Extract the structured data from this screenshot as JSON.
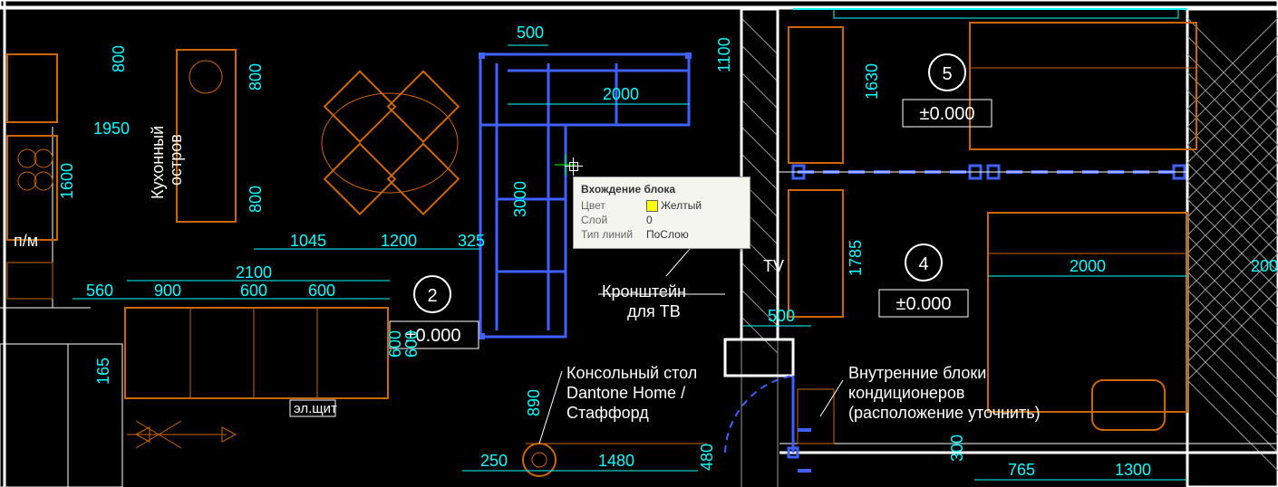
{
  "tooltip": {
    "title": "Вхождение блока",
    "color_label": "Цвет",
    "color_value": "Желтый",
    "layer_label": "Слой",
    "layer_value": "0",
    "linetype_label": "Тип линий",
    "linetype_value": "ПоСлою"
  },
  "labels": {
    "kitchen_island_1": "Кухонный",
    "kitchen_island_2": "остров",
    "pm": "п/м",
    "tv_bracket_1": "Кронштейн",
    "tv_bracket_2": "для ТВ",
    "console_1": "Консольный стол",
    "console_2": "Dantone Home /",
    "console_3": "Стаффорд",
    "tv": "TV",
    "ac_1": "Внутренние блоки",
    "ac_2": "кондиционеров",
    "ac_3": "(расположение уточнить)",
    "panel": "эл.щит"
  },
  "rooms": {
    "r2": {
      "num": "2",
      "elev": "±0.000"
    },
    "r4": {
      "num": "4",
      "elev": "±0.000"
    },
    "r5": {
      "num": "5",
      "elev": "±0.000"
    }
  },
  "dims": {
    "d500": "500",
    "d800a": "800",
    "d800b": "800",
    "d800c": "800",
    "d1950": "1950",
    "d1600": "1600",
    "d2000": "2000",
    "d1100": "1100",
    "d1630": "1630",
    "d3000": "3000",
    "d1785": "1785",
    "d1045": "1045",
    "d1200": "1200",
    "d325": "325",
    "d2100": "2100",
    "d560": "560",
    "d900": "900",
    "d600a": "600",
    "d600b": "600",
    "d600c": "600",
    "d600d": "600",
    "d165": "165",
    "d890": "890",
    "d250": "250",
    "d1480": "1480",
    "d500b": "500",
    "d480": "480",
    "d2000b": "2000",
    "d200": "200",
    "d300": "300",
    "d765": "765",
    "d1300": "1300"
  }
}
